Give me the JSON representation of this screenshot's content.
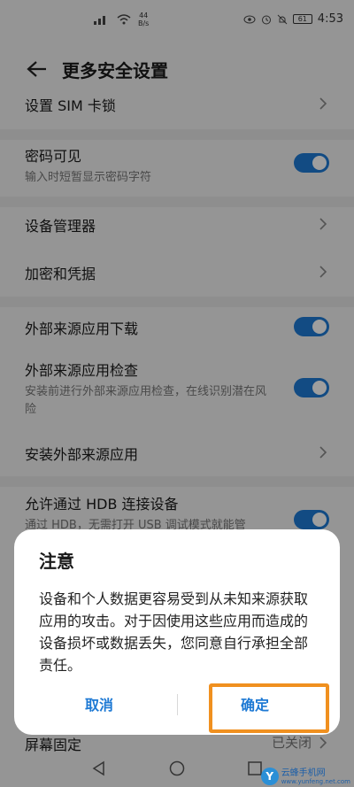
{
  "status_bar": {
    "net_speed_value": "44",
    "net_speed_unit": "B/s",
    "battery": "61",
    "time": "4:53"
  },
  "header": {
    "title": "更多安全设置"
  },
  "settings": {
    "sim_lock": "设置 SIM 卡锁",
    "password_visible": {
      "title": "密码可见",
      "subtitle": "输入时短暂显示密码字符",
      "on": true
    },
    "device_manager": "设备管理器",
    "encryption": "加密和凭据",
    "external_download": {
      "title": "外部来源应用下载",
      "on": true
    },
    "external_check": {
      "title": "外部来源应用检查",
      "subtitle": "安装前进行外部来源应用检查，在线识别潜在风险",
      "on": true
    },
    "install_external": "安装外部来源应用",
    "hdb": {
      "title": "允许通过 HDB 连接设备",
      "subtitle": "通过 HDB，无需打开 USB 调试模式就能管",
      "on": true
    },
    "screen_pin": {
      "title": "屏幕固定",
      "value": "已关闭"
    }
  },
  "dialog": {
    "title": "注意",
    "message": "设备和个人数据更容易受到从未知来源获取应用的攻击。对于因使用这些应用而造成的设备损坏或数据丢失，您同意自行承担全部责任。",
    "cancel": "取消",
    "confirm": "确定"
  },
  "watermark": {
    "logo": "Y",
    "name": "云蜂手机网",
    "url": "www.yunfeng.net.com"
  },
  "colors": {
    "accent": "#1d79d4",
    "highlight": "#f0901f"
  }
}
